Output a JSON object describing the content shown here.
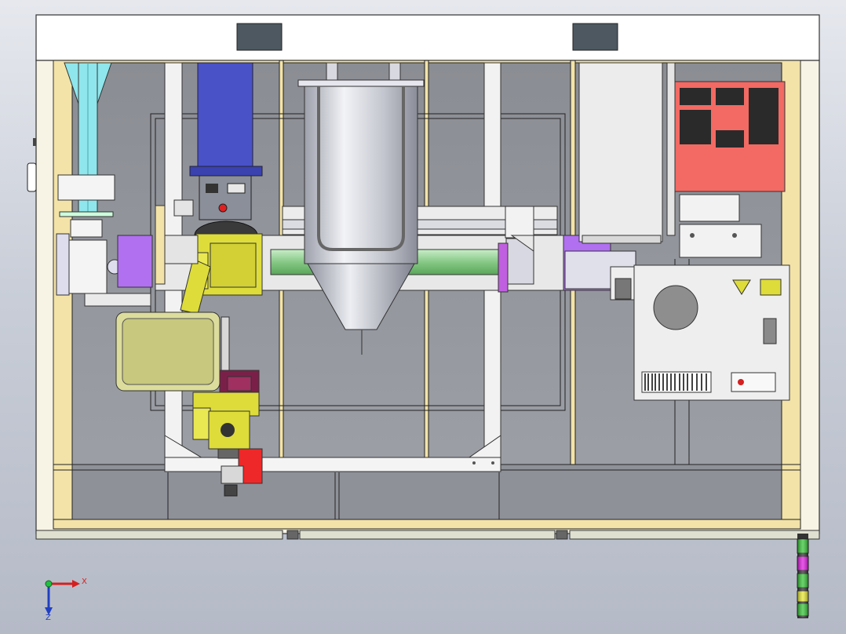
{
  "view": {
    "background_top": "#e6e8ee",
    "background_bottom": "#b5bac7"
  },
  "triad": {
    "x_label": "X",
    "z_label": "Z",
    "x_color": "#d42020",
    "z_color": "#2040c0",
    "origin_color": "#20c040"
  },
  "colors": {
    "enclosure_wall": "#ffffff",
    "interior_panel": "#8e9098",
    "frame_yellow": "#f3e3a8",
    "hopper_cyan": "#8fe6ec",
    "motor_blue": "#4a52c8",
    "robot_yellow": "#dedc3a",
    "tank_silver": "#c9cbd4",
    "rail_green": "#8fd08f",
    "flange_purple": "#b070f0",
    "control_box_red": "#f26a63",
    "cabinet_light": "#eeeeee",
    "tray_beige": "#dcdc9c",
    "gripper_magenta": "#7a2048",
    "gripper_red": "#ee2828",
    "tower_green": "#3ac63a",
    "tower_magenta": "#e020e0",
    "tower_yellow": "#e8e838"
  },
  "signal_tower": {
    "segments": [
      "green",
      "magenta",
      "green",
      "green",
      "yellow",
      "green"
    ]
  }
}
